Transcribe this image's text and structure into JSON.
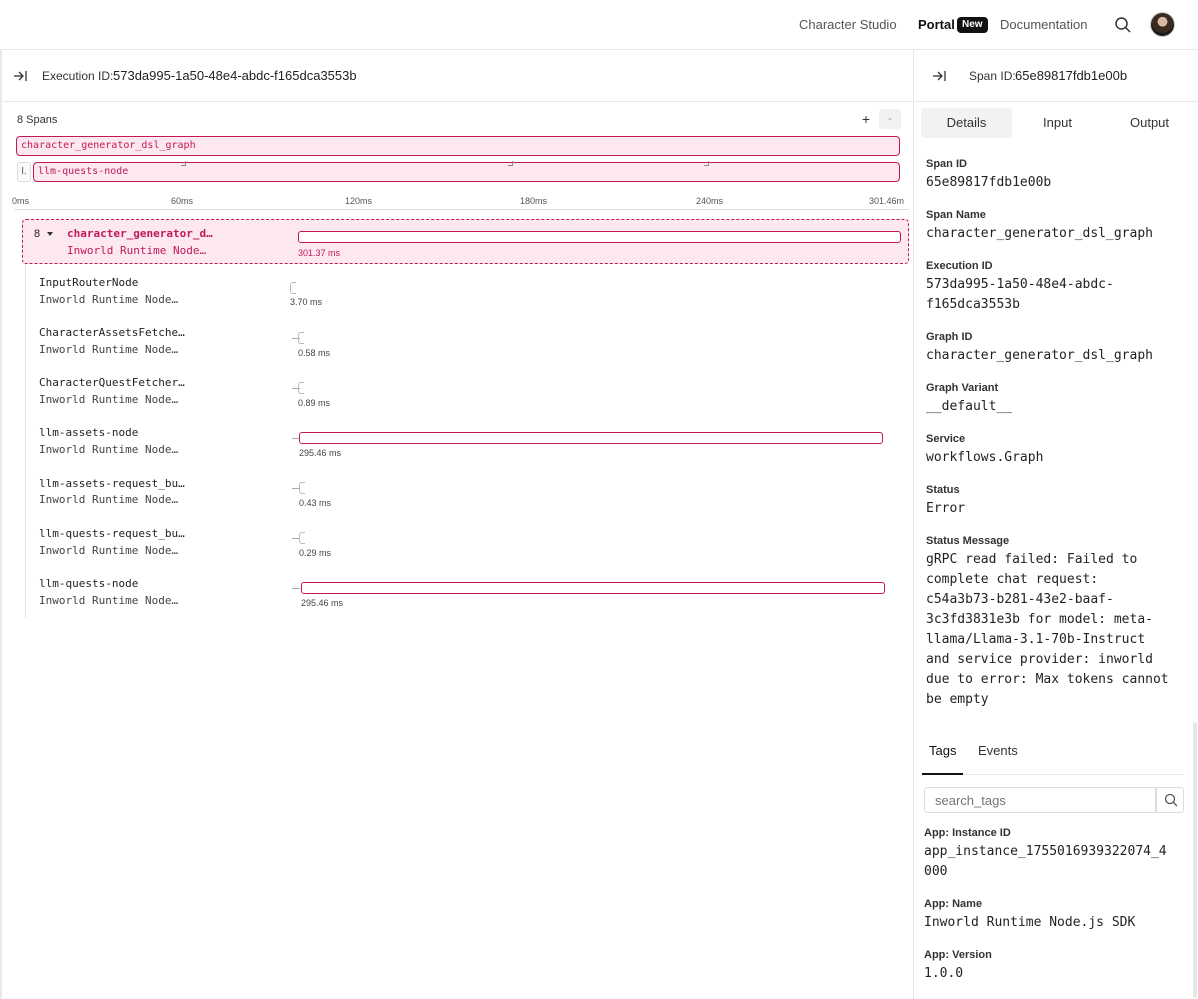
{
  "nav": {
    "links": [
      "Character Studio",
      "Portal",
      "Documentation"
    ],
    "new_badge": "New",
    "search_icon": "search-icon",
    "avatar": "user-avatar"
  },
  "execution": {
    "label": "Execution ID:",
    "id": "573da995-1a50-48e4-abdc-f165dca3553b"
  },
  "timeline": {
    "spans_count": "8 Spans",
    "zoom_in": "+",
    "zoom_out": "-",
    "minimap": {
      "root": "character_generator_dsl_graph",
      "child_prefix": "I.",
      "child": "llm-quests-node"
    },
    "axis": [
      "0ms",
      "60ms",
      "120ms",
      "180ms",
      "240ms",
      "301.46m"
    ],
    "root": {
      "count": "8",
      "name": "character_generator_d…",
      "sub": "Inworld Runtime Node…",
      "duration": "301.37 ms",
      "fraction": 0.9997
    },
    "rows": [
      {
        "name": "InputRouterNode",
        "sub": "Inworld Runtime Node…",
        "duration": "3.70 ms"
      },
      {
        "name": "CharacterAssetsFetche…",
        "sub": "Inworld Runtime Node…",
        "duration": "0.58 ms"
      },
      {
        "name": "CharacterQuestFetcher…",
        "sub": "Inworld Runtime Node…",
        "duration": "0.89 ms"
      },
      {
        "name": "llm-assets-node",
        "sub": "Inworld Runtime Node…",
        "duration": "295.46 ms"
      },
      {
        "name": "llm-assets-request_bu…",
        "sub": "Inworld Runtime Node…",
        "duration": "0.43 ms"
      },
      {
        "name": "llm-quests-request_bu…",
        "sub": "Inworld Runtime Node…",
        "duration": "0.29 ms"
      },
      {
        "name": "llm-quests-node",
        "sub": "Inworld Runtime Node…",
        "duration": "295.46 ms"
      }
    ]
  },
  "span": {
    "label": "Span ID:",
    "id": "65e89817fdb1e00b",
    "tabs": [
      "Details",
      "Input",
      "Output"
    ],
    "fields": [
      {
        "label": "Span ID",
        "value": "65e89817fdb1e00b"
      },
      {
        "label": "Span Name",
        "value": "character_generator_dsl_graph"
      },
      {
        "label": "Execution ID",
        "value": "573da995-1a50-48e4-abdc-\nf165dca3553b"
      },
      {
        "label": "Graph ID",
        "value": "character_generator_dsl_graph"
      },
      {
        "label": "Graph Variant",
        "value": "__default__"
      },
      {
        "label": "Service",
        "value": "workflows.Graph"
      },
      {
        "label": "Status",
        "value": "Error"
      },
      {
        "label": "Status Message",
        "value": "gRPC read failed: Failed to\ncomplete chat request:\nc54a3b73-b281-43e2-baaf-\n3c3fd3831e3b for model: meta-\nllama/Llama-3.1-70b-Instruct\nand service provider: inworld\ndue to error: Max tokens cannot\nbe empty"
      }
    ],
    "tags_tabs": [
      "Tags",
      "Events"
    ],
    "search_placeholder": "search_tags",
    "tags": [
      {
        "label": "App: Instance ID",
        "value": "app_instance_1755016939322074_4\n000"
      },
      {
        "label": "App: Name",
        "value": "Inworld Runtime Node.js SDK"
      },
      {
        "label": "App: Version",
        "value": "1.0.0"
      }
    ]
  }
}
